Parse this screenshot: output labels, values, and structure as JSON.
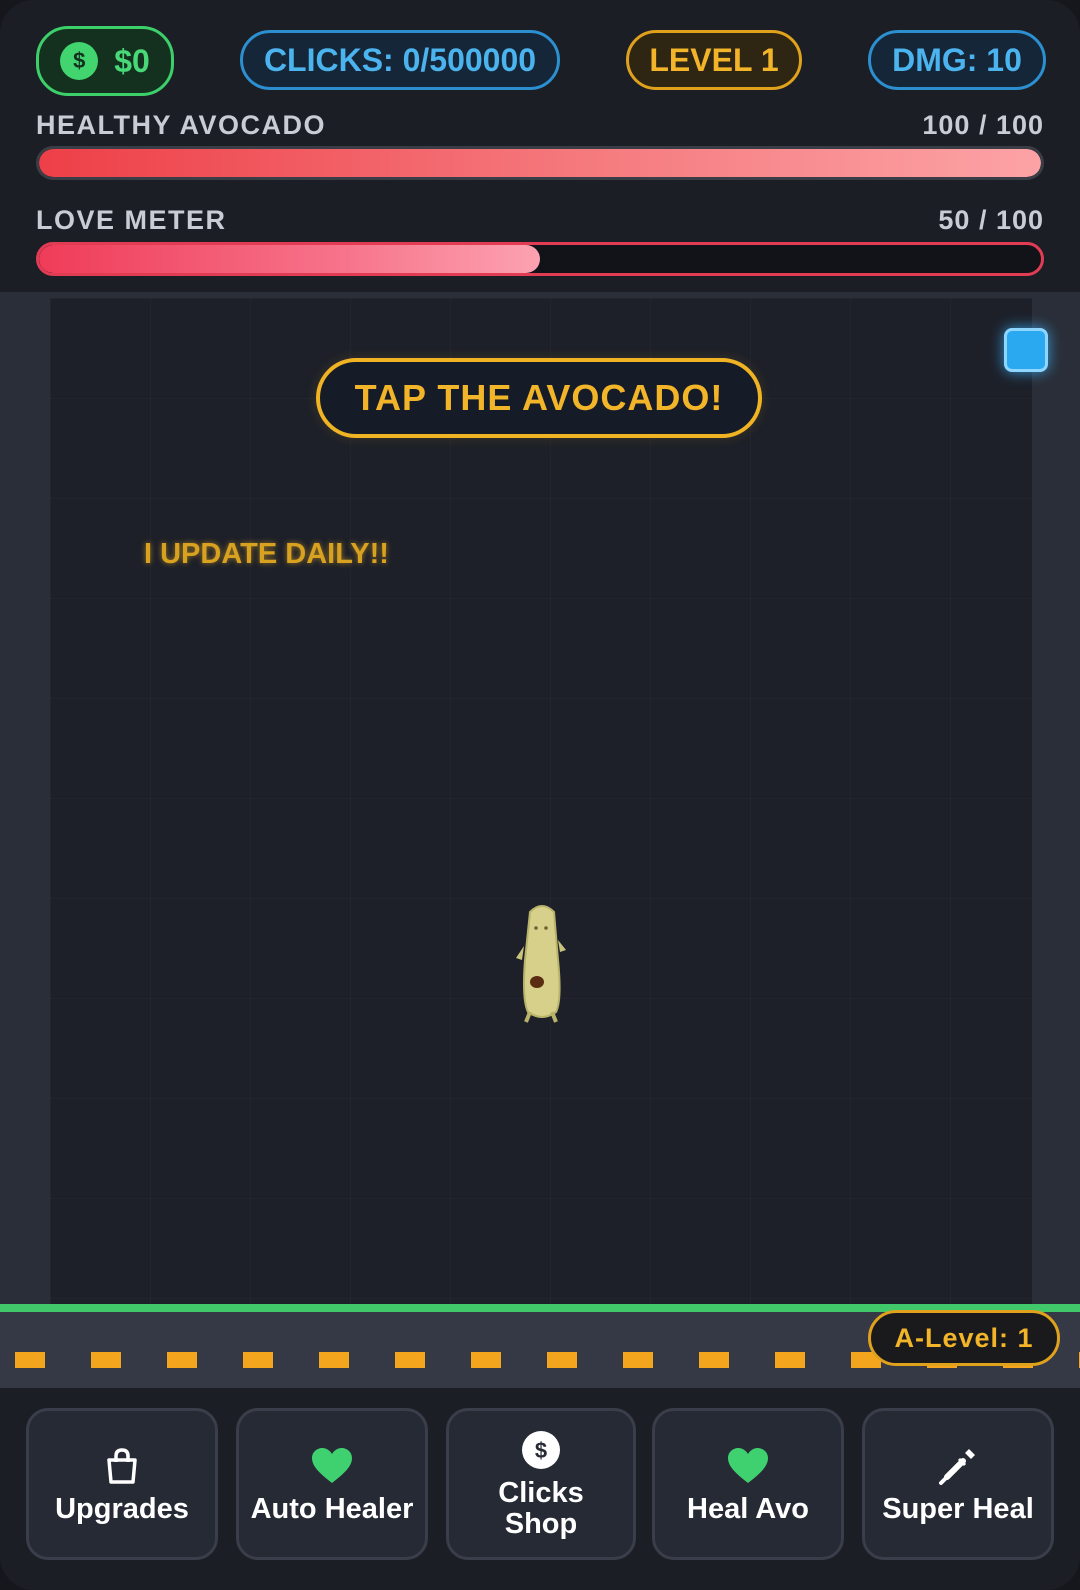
{
  "hud": {
    "money": "$0",
    "money_icon": "$",
    "clicks": "CLICKS: 0/500000",
    "level": "LEVEL 1",
    "damage": "DMG: 10"
  },
  "health_bar": {
    "label": "HEALTHY AVOCADO",
    "value_text": "100 / 100",
    "current": 100,
    "max": 100,
    "colors": [
      "#ee3f48",
      "#fca3a6"
    ]
  },
  "love_bar": {
    "label": "LOVE METER",
    "value_text": "50 / 100",
    "current": 50,
    "max": 100,
    "colors": [
      "#ef3c59",
      "#fca2b1"
    ]
  },
  "field": {
    "tap_prompt": "TAP THE AVOCADO!",
    "daily_text": "I UPDATE DAILY!!",
    "character": "avocado-character",
    "toggle_icon": "blue-square-icon"
  },
  "ground": {
    "a_level": "A-Level: 1"
  },
  "buttons": [
    {
      "label": "Upgrades",
      "icon": "shopping-bag-icon"
    },
    {
      "label": "Auto Healer",
      "icon": "heart-icon"
    },
    {
      "label": "Clicks Shop",
      "icon": "coin-icon",
      "icon_text": "$"
    },
    {
      "label": "Heal Avo",
      "icon": "heart-icon"
    },
    {
      "label": "Super Heal",
      "icon": "syringe-icon"
    }
  ],
  "colors": {
    "green": "#40c86a",
    "blue": "#4bb3ee",
    "gold": "#f2b428",
    "red": "#e23c55",
    "background": "#1d2029"
  }
}
